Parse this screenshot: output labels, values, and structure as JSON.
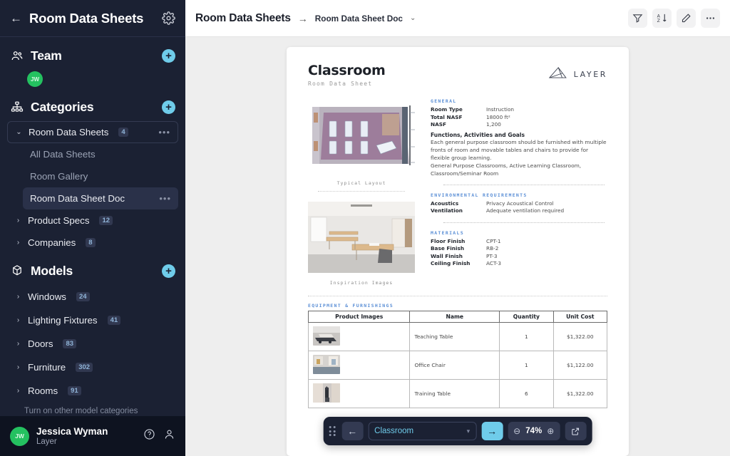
{
  "sidebar": {
    "back_icon": "arrow-left-icon",
    "title": "Room Data Sheets",
    "gear_icon": "gear-icon",
    "team": {
      "label": "Team",
      "icon": "users-icon",
      "add_label": "+",
      "members": [
        {
          "initials": "JW"
        }
      ]
    },
    "categories": {
      "label": "Categories",
      "icon": "hierarchy-icon",
      "add_label": "+",
      "items": [
        {
          "label": "Room Data Sheets",
          "count": "4",
          "expanded": true,
          "has_menu": true
        },
        {
          "label": "All Data Sheets",
          "sub": true
        },
        {
          "label": "Room Gallery",
          "sub": true
        },
        {
          "label": "Room Data Sheet Doc",
          "sub": true,
          "active": true,
          "has_menu": true
        },
        {
          "label": "Product Specs",
          "count": "12"
        },
        {
          "label": "Companies",
          "count": "8"
        }
      ]
    },
    "models": {
      "label": "Models",
      "icon": "cube-icon",
      "add_label": "+",
      "items": [
        {
          "label": "Windows",
          "count": "24"
        },
        {
          "label": "Lighting Fixtures",
          "count": "41"
        },
        {
          "label": "Doors",
          "count": "83"
        },
        {
          "label": "Furniture",
          "count": "302"
        },
        {
          "label": "Rooms",
          "count": "91"
        }
      ],
      "footer_link": "Turn on other model categories"
    },
    "user": {
      "initials": "JW",
      "name": "Jessica Wyman",
      "org": "Layer",
      "help_icon": "help-circle-icon",
      "account_icon": "user-icon"
    }
  },
  "topbar": {
    "breadcrumb_main": "Room Data Sheets",
    "breadcrumb_arrow": "→",
    "breadcrumb_sub": "Room Data Sheet Doc",
    "breadcrumb_chevron": "⌄",
    "actions": [
      {
        "name": "filter-button",
        "icon": "filter-icon"
      },
      {
        "name": "sort-button",
        "icon": "sort-az-icon"
      },
      {
        "name": "edit-button",
        "icon": "pencil-icon"
      },
      {
        "name": "more-button",
        "icon": "ellipsis-icon"
      }
    ]
  },
  "document": {
    "title": "Classroom",
    "subtitle": "Room Data Sheet",
    "brand": "LAYER",
    "brand_icon": "layer-logo-icon",
    "figures": [
      {
        "caption": "Typical Layout",
        "name": "typical-layout-image"
      },
      {
        "caption": "Inspiration Images",
        "name": "inspiration-image"
      }
    ],
    "sections": [
      {
        "title": "GENERAL",
        "specs": [
          {
            "key": "Room Type",
            "value": "Instruction"
          },
          {
            "key": "Total NASF",
            "value": "18000 ft²"
          },
          {
            "key": "NASF",
            "value": "1,200"
          }
        ],
        "para_heading": "Functions, Activities and Goals",
        "paragraphs": [
          "Each general purpose classroom should be furnished with multiple fronts of room and movable tables and chairs to provide for flexible group learning.",
          "General Purpose Classrooms, Active Learning Classroom, Classroom/Seminar Room"
        ]
      },
      {
        "title": "ENVIRONMENTAL  REQUIREMENTS",
        "specs": [
          {
            "key": "Acoustics",
            "value": "Privacy Acoustical Control"
          },
          {
            "key": "Ventilation",
            "value": "Adequate ventilation required"
          }
        ]
      },
      {
        "title": "MATERIALS",
        "specs": [
          {
            "key": "Floor Finish",
            "value": "CPT-1"
          },
          {
            "key": "Base Finish",
            "value": "RB-2"
          },
          {
            "key": "Wall Finish",
            "value": "PT-3"
          },
          {
            "key": "Ceiling Finish",
            "value": "ACT-3"
          }
        ]
      }
    ],
    "equipment": {
      "title": "EQUIPMENT & FURNISHINGS",
      "columns": [
        "Product Images",
        "Name",
        "Quantity",
        "Unit Cost"
      ],
      "rows": [
        {
          "name": "Teaching Table",
          "quantity": "1",
          "unit_cost": "$1,322.00"
        },
        {
          "name": "Office Chair",
          "quantity": "1",
          "unit_cost": "$1,122.00"
        },
        {
          "name": "Training Table",
          "quantity": "6",
          "unit_cost": "$1,322.00"
        }
      ]
    }
  },
  "floatbar": {
    "drag_icon": "drag-handle-icon",
    "prev_label": "←",
    "select_value": "Classroom",
    "select_chevron": "▾",
    "next_label": "→",
    "zoom_out": "⊖",
    "zoom_level": "74%",
    "zoom_in": "⊕",
    "expand_icon": "open-external-icon"
  },
  "colors": {
    "sidebar_bg": "#1b2133",
    "accent": "#6fccea",
    "avatar_green": "#24c160",
    "section_blue": "#5b8fd6"
  }
}
